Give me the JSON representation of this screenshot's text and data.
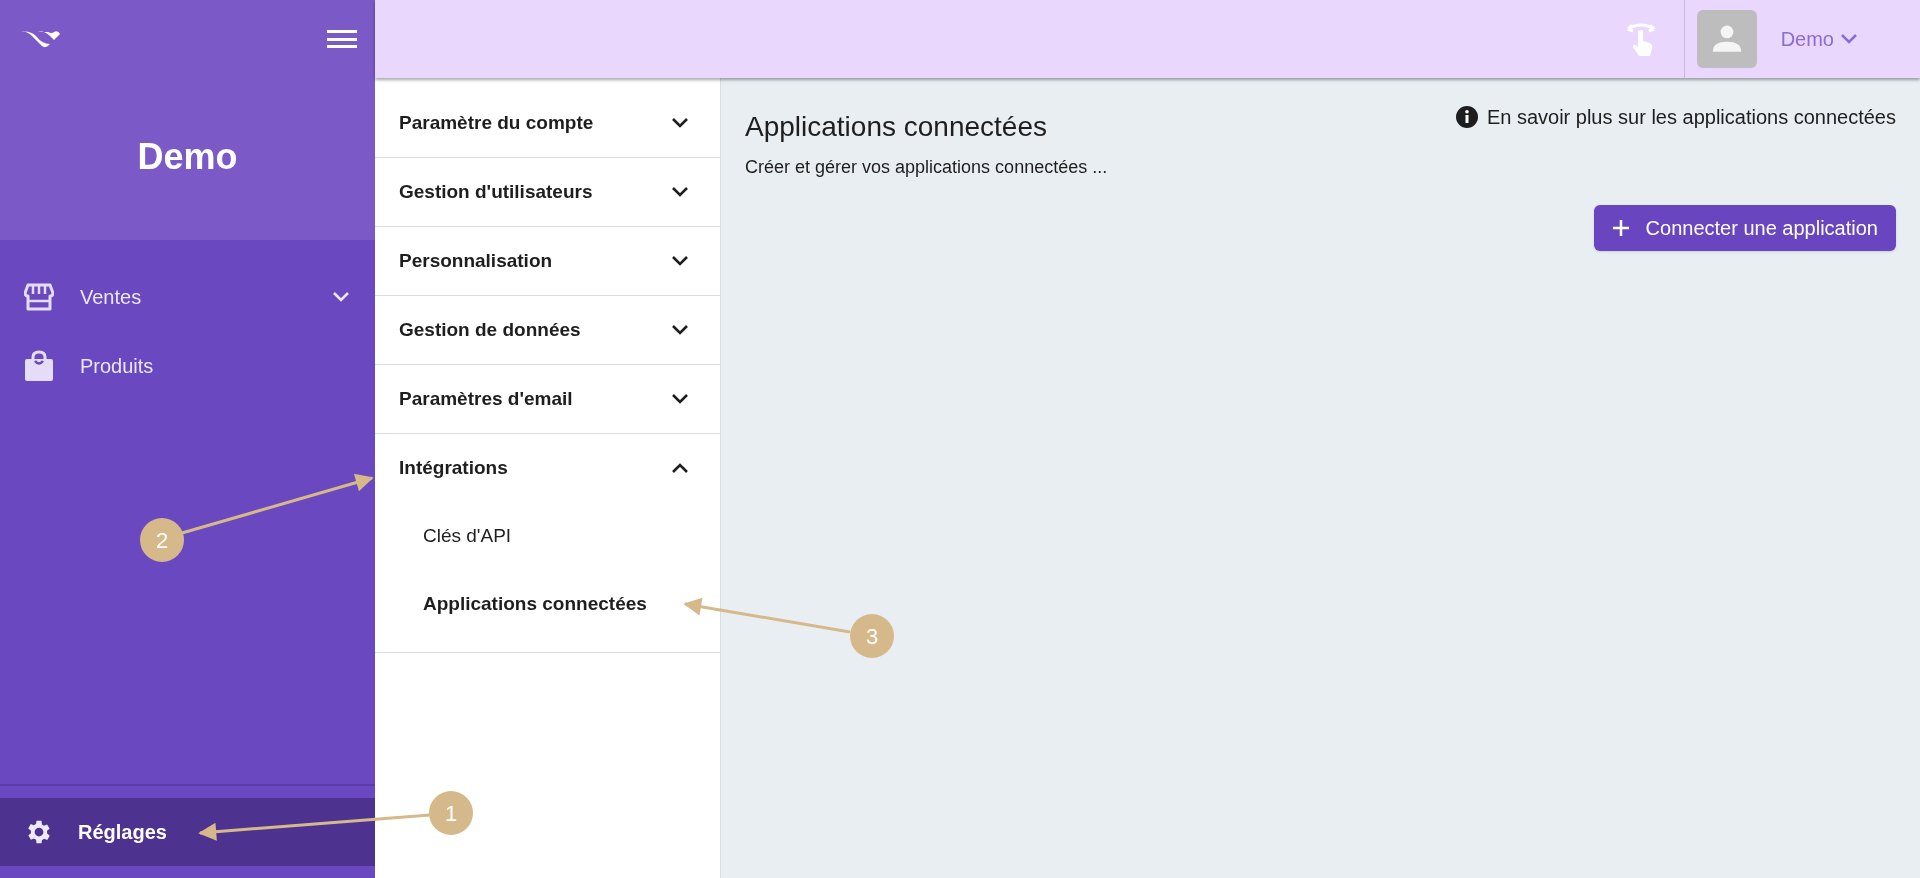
{
  "sidebar": {
    "brand": "Demo",
    "items": [
      {
        "label": "Ventes",
        "kind": "group",
        "selected": false
      },
      {
        "label": "Produits",
        "kind": "link",
        "selected": false
      }
    ],
    "footer_item": {
      "label": "Réglages",
      "selected": true
    }
  },
  "top_bar": {
    "user": "Demo"
  },
  "settings_menu": {
    "sections": [
      {
        "label": "Paramètre du compte",
        "expanded": false
      },
      {
        "label": "Gestion d'utilisateurs",
        "expanded": false
      },
      {
        "label": "Personnalisation",
        "expanded": false
      },
      {
        "label": "Gestion de données",
        "expanded": false
      },
      {
        "label": "Paramètres d'email",
        "expanded": false
      },
      {
        "label": "Intégrations",
        "expanded": true,
        "children": [
          {
            "label": "Clés d'API",
            "selected": false
          },
          {
            "label": "Applications connectées",
            "selected": true
          }
        ]
      }
    ]
  },
  "main": {
    "title": "Applications connectées",
    "subtitle": "Créer et gérer vos applications connectées ...",
    "help_link": "En savoir plus sur les applications connectées",
    "primary_button": "Connecter une application"
  },
  "annotations": [
    {
      "number": "1"
    },
    {
      "number": "2"
    },
    {
      "number": "3"
    }
  ]
}
